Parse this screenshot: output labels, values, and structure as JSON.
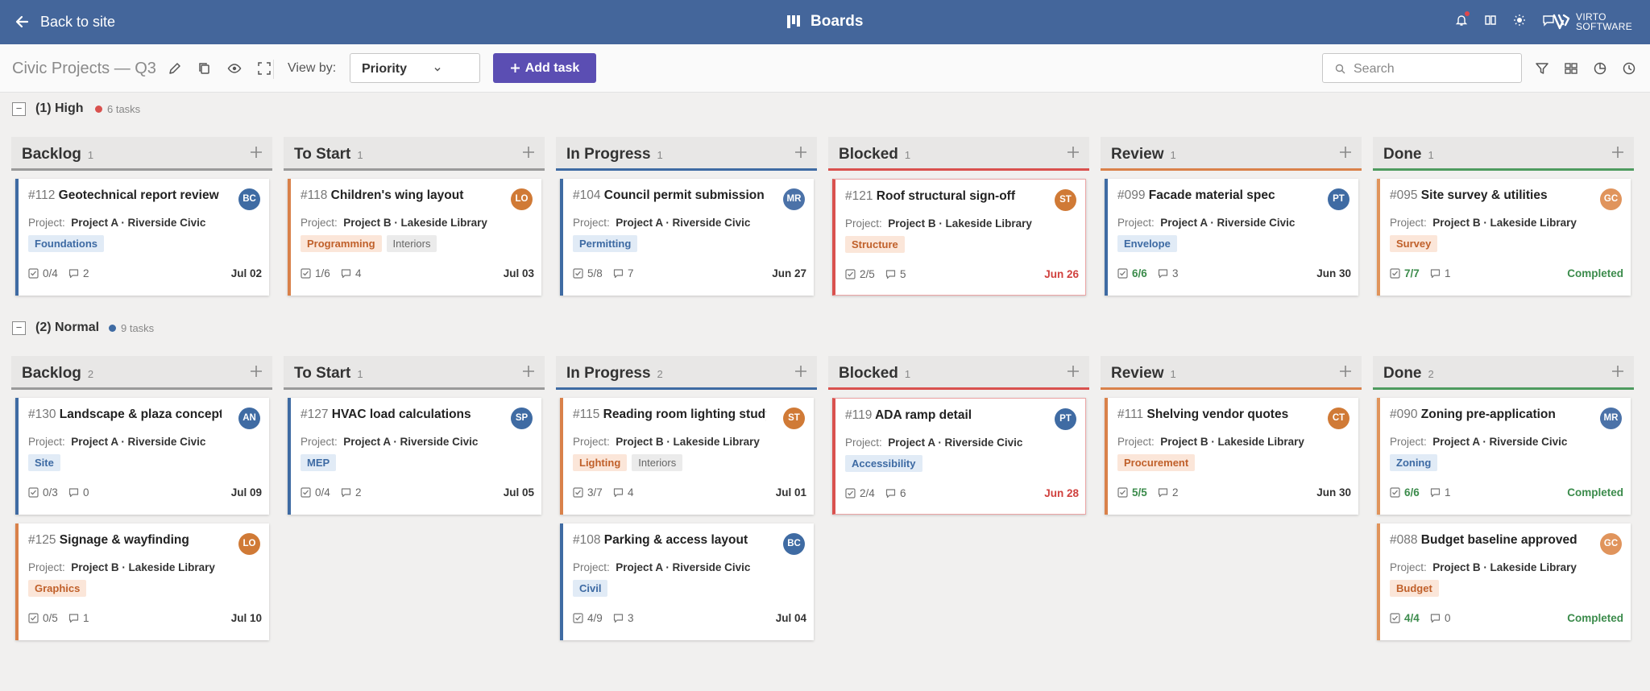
{
  "topbar": {
    "back_label": "Back to site",
    "title": "Boards",
    "logo_line1": "VIRTO",
    "logo_line2": "SOFTWARE"
  },
  "toolbar": {
    "board_title": "Civic Projects — Q3",
    "view_by_label": "View by:",
    "view_by_value": "Priority",
    "add_task_label": "Add task",
    "search_placeholder": "Search"
  },
  "project_label": "Project:",
  "colors": {
    "topbar": "#44669b",
    "accent": "#5b4eb3",
    "blue": "#3f6ba3",
    "orange": "#d9814a",
    "red": "#d9514e",
    "green": "#4e9b5f"
  },
  "groups": [
    {
      "name": "(1) High",
      "dot_color": "#d9514e",
      "count": "6 tasks",
      "columns": [
        {
          "name": "Backlog",
          "count": "1",
          "cards": [
            {
              "id": "#112",
              "title": "Geotechnical report review",
              "avatar": "BC",
              "avatar_color": "#3f6ba3",
              "accent": "#3f6ba3",
              "project": "Project A · Riverside Civic",
              "tags": [
                {
                  "text": "Foundations",
                  "style": "blue"
                }
              ],
              "checklist": "0/4",
              "comments": "2",
              "due": "Jul 02",
              "due_style": ""
            }
          ]
        },
        {
          "name": "To Start",
          "count": "1",
          "cards": [
            {
              "id": "#118",
              "title": "Children's wing layout",
              "avatar": "LO",
              "avatar_color": "#d07a36",
              "accent": "#d9814a",
              "project": "Project B · Lakeside Library",
              "tags": [
                {
                  "text": "Programming",
                  "style": "orange"
                },
                {
                  "text": "Interiors",
                  "style": "gray"
                }
              ],
              "checklist": "1/6",
              "comments": "4",
              "due": "Jul 03",
              "due_style": ""
            }
          ]
        },
        {
          "name": "In Progress",
          "count": "1",
          "cards": [
            {
              "id": "#104",
              "title": "Council permit submission",
              "avatar": "MR",
              "avatar_color": "#4b72a8",
              "accent": "#3f6ba3",
              "project": "Project A · Riverside Civic",
              "tags": [
                {
                  "text": "Permitting",
                  "style": "blue"
                }
              ],
              "checklist": "5/8",
              "comments": "7",
              "due": "Jun 27",
              "due_style": ""
            }
          ]
        },
        {
          "name": "Blocked",
          "count": "1",
          "cards": [
            {
              "id": "#121",
              "title": "Roof structural sign-off",
              "avatar": "ST",
              "avatar_color": "#d07a36",
              "accent": "#d9514e",
              "red": true,
              "project": "Project B · Lakeside Library",
              "tags": [
                {
                  "text": "Structure",
                  "style": "orange"
                }
              ],
              "checklist": "2/5",
              "comments": "5",
              "due": "Jun 26",
              "due_style": "red"
            }
          ]
        },
        {
          "name": "Review",
          "count": "1",
          "cards": [
            {
              "id": "#099",
              "title": "Facade material spec",
              "avatar": "PT",
              "avatar_color": "#3f6ba3",
              "accent": "#3f6ba3",
              "project": "Project A · Riverside Civic",
              "tags": [
                {
                  "text": "Envelope",
                  "style": "blue"
                }
              ],
              "checklist": "6/6",
              "checklist_done": true,
              "comments": "3",
              "due": "Jun 30",
              "due_style": ""
            }
          ]
        },
        {
          "name": "Done",
          "count": "1",
          "cards": [
            {
              "id": "#095",
              "title": "Site survey & utilities",
              "avatar": "GC",
              "avatar_color": "#e0945c",
              "accent": "#e0945c",
              "project": "Project B · Lakeside Library",
              "tags": [
                {
                  "text": "Survey",
                  "style": "orange"
                }
              ],
              "checklist": "7/7",
              "checklist_done": true,
              "comments": "1",
              "due": "Completed",
              "due_style": "green"
            }
          ]
        }
      ]
    },
    {
      "name": "(2) Normal",
      "dot_color": "#3f6ba3",
      "count": "9 tasks",
      "columns": [
        {
          "name": "Backlog",
          "count": "2",
          "cards": [
            {
              "id": "#130",
              "title": "Landscape & plaza concept",
              "avatar": "AN",
              "avatar_color": "#3f6ba3",
              "accent": "#3f6ba3",
              "project": "Project A · Riverside Civic",
              "tags": [
                {
                  "text": "Site",
                  "style": "blue"
                }
              ],
              "checklist": "0/3",
              "comments": "0",
              "due": "Jul 09",
              "due_style": ""
            },
            {
              "id": "#125",
              "title": "Signage & wayfinding",
              "avatar": "LO",
              "avatar_color": "#d07a36",
              "accent": "#d9814a",
              "project": "Project B · Lakeside Library",
              "tags": [
                {
                  "text": "Graphics",
                  "style": "orange"
                }
              ],
              "checklist": "0/5",
              "comments": "1",
              "due": "Jul 10",
              "due_style": ""
            }
          ]
        },
        {
          "name": "To Start",
          "count": "1",
          "cards": [
            {
              "id": "#127",
              "title": "HVAC load calculations",
              "avatar": "SP",
              "avatar_color": "#3f6ba3",
              "accent": "#3f6ba3",
              "project": "Project A · Riverside Civic",
              "tags": [
                {
                  "text": "MEP",
                  "style": "blue"
                }
              ],
              "checklist": "0/4",
              "comments": "2",
              "due": "Jul 05",
              "due_style": ""
            }
          ]
        },
        {
          "name": "In Progress",
          "count": "2",
          "cards": [
            {
              "id": "#115",
              "title": "Reading room lighting study",
              "avatar": "ST",
              "avatar_color": "#d07a36",
              "accent": "#d9814a",
              "project": "Project B · Lakeside Library",
              "tags": [
                {
                  "text": "Lighting",
                  "style": "orange"
                },
                {
                  "text": "Interiors",
                  "style": "gray"
                }
              ],
              "checklist": "3/7",
              "comments": "4",
              "due": "Jul 01",
              "due_style": ""
            },
            {
              "id": "#108",
              "title": "Parking & access layout",
              "avatar": "BC",
              "avatar_color": "#3f6ba3",
              "accent": "#3f6ba3",
              "project": "Project A · Riverside Civic",
              "tags": [
                {
                  "text": "Civil",
                  "style": "blue"
                }
              ],
              "checklist": "4/9",
              "comments": "3",
              "due": "Jul 04",
              "due_style": ""
            }
          ]
        },
        {
          "name": "Blocked",
          "count": "1",
          "cards": [
            {
              "id": "#119",
              "title": "ADA ramp detail",
              "avatar": "PT",
              "avatar_color": "#3f6ba3",
              "accent": "#d9514e",
              "red": true,
              "project": "Project A · Riverside Civic",
              "tags": [
                {
                  "text": "Accessibility",
                  "style": "blue"
                }
              ],
              "checklist": "2/4",
              "comments": "6",
              "due": "Jun 28",
              "due_style": "red"
            }
          ]
        },
        {
          "name": "Review",
          "count": "1",
          "cards": [
            {
              "id": "#111",
              "title": "Shelving vendor quotes",
              "avatar": "CT",
              "avatar_color": "#d07a36",
              "accent": "#d9814a",
              "project": "Project B · Lakeside Library",
              "tags": [
                {
                  "text": "Procurement",
                  "style": "orange"
                }
              ],
              "checklist": "5/5",
              "checklist_done": true,
              "comments": "2",
              "due": "Jun 30",
              "due_style": ""
            }
          ]
        },
        {
          "name": "Done",
          "count": "2",
          "cards": [
            {
              "id": "#090",
              "title": "Zoning pre-application",
              "avatar": "MR",
              "avatar_color": "#4b72a8",
              "accent": "#e0945c",
              "project": "Project A · Riverside Civic",
              "tags": [
                {
                  "text": "Zoning",
                  "style": "blue"
                }
              ],
              "checklist": "6/6",
              "checklist_done": true,
              "comments": "1",
              "due": "Completed",
              "due_style": "green"
            },
            {
              "id": "#088",
              "title": "Budget baseline approved",
              "avatar": "GC",
              "avatar_color": "#e0945c",
              "accent": "#e0945c",
              "project": "Project B · Lakeside Library",
              "tags": [
                {
                  "text": "Budget",
                  "style": "orange"
                }
              ],
              "checklist": "4/4",
              "checklist_done": true,
              "comments": "0",
              "due": "Completed",
              "due_style": "green"
            }
          ]
        }
      ]
    }
  ],
  "column_underline_colors": [
    "#9a9a9a",
    "#9a9a9a",
    "#3f6ba3",
    "#d9514e",
    "#d9814a",
    "#4e9b5f"
  ]
}
